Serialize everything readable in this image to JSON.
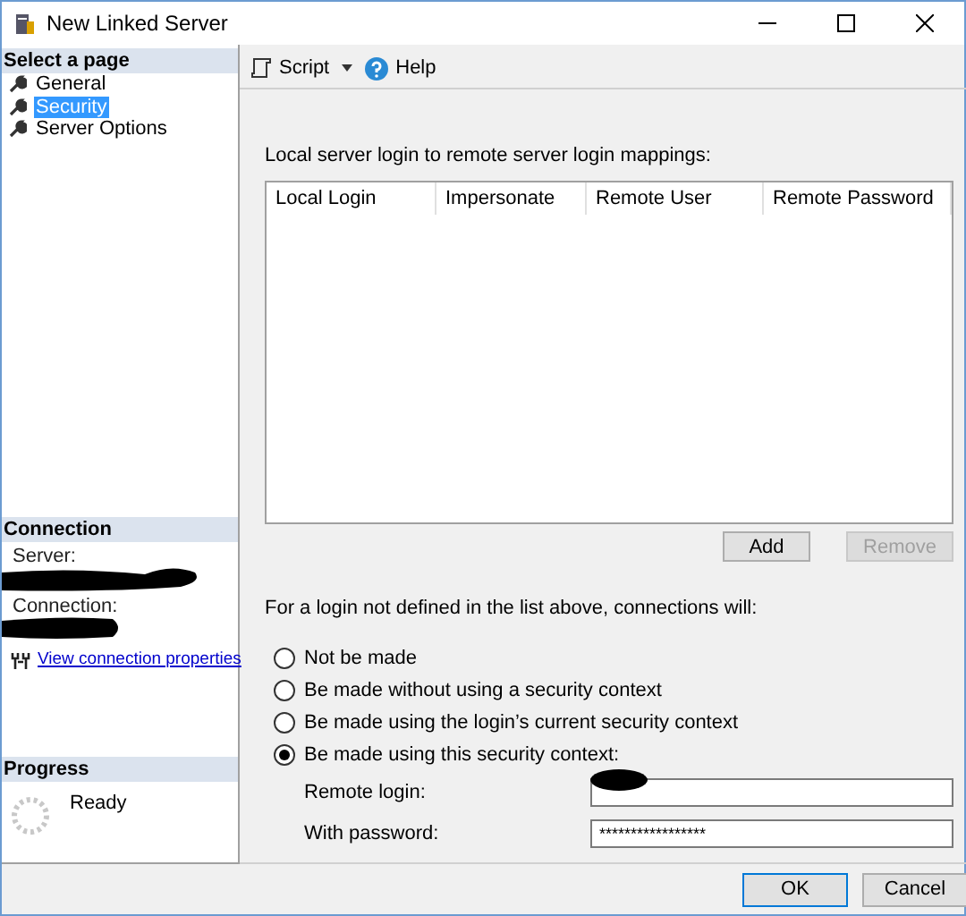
{
  "window": {
    "title": "New Linked Server"
  },
  "sidebar": {
    "header": "Select a page",
    "items": [
      {
        "label": "General",
        "selected": false
      },
      {
        "label": "Security",
        "selected": true
      },
      {
        "label": "Server Options",
        "selected": false
      }
    ]
  },
  "connection": {
    "header": "Connection",
    "server_label": "Server:",
    "connection_label": "Connection:",
    "link": "View connection properties"
  },
  "progress": {
    "header": "Progress",
    "status": "Ready"
  },
  "toolbar": {
    "script": "Script",
    "help": "Help"
  },
  "mappings": {
    "caption": "Local server login to remote server login mappings:",
    "columns": [
      "Local Login",
      "Impersonate",
      "Remote User",
      "Remote Password"
    ],
    "buttons": [
      {
        "label": "Add",
        "disabled": false
      },
      {
        "label": "Remove",
        "disabled": true
      }
    ]
  },
  "fallback": {
    "caption": "For a login not defined in the list above, connections will:",
    "options": [
      {
        "label": "Not be made",
        "selected": false
      },
      {
        "label": "Be made without using a security context",
        "selected": false
      },
      {
        "label": "Be made using the login’s current security context",
        "selected": false
      },
      {
        "label": "Be made using this security context:",
        "selected": true
      }
    ],
    "remote_login_label": "Remote login:",
    "password_label": "With password:",
    "password_value": "*****************"
  },
  "footer": {
    "buttons": [
      {
        "label": "OK",
        "default": true
      },
      {
        "label": "Cancel",
        "default": false
      }
    ]
  }
}
